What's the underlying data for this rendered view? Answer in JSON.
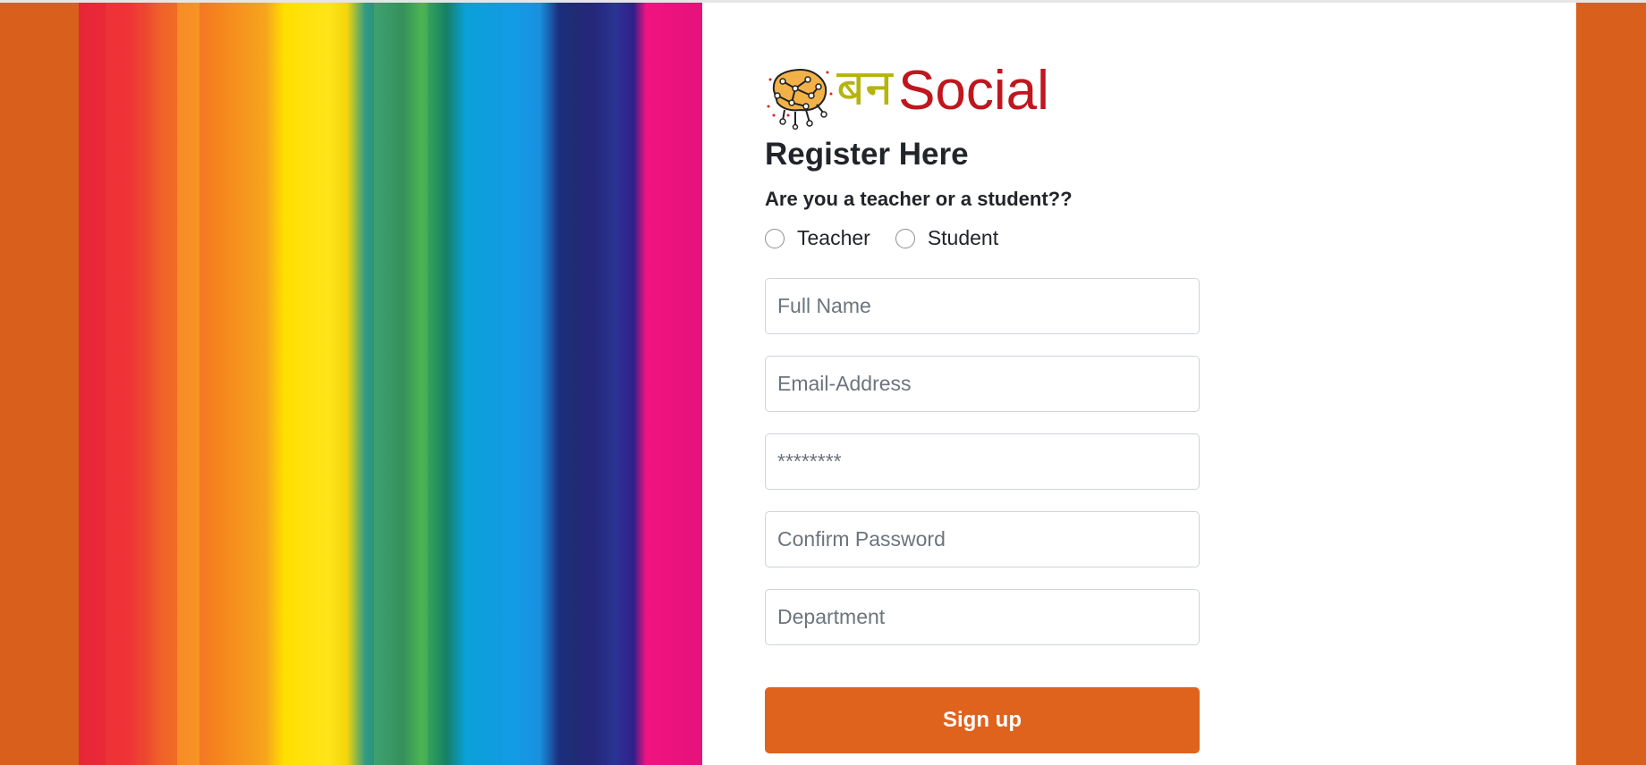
{
  "colors": {
    "page_background": "#d9601c",
    "button_background": "#e0631d",
    "brand_hindi": "#b5b40f",
    "brand_social": "#c0161e"
  },
  "brand": {
    "logo_icon": "brain-network-icon",
    "hindi_text": "बन",
    "social_text": "Social"
  },
  "form": {
    "title": "Register Here",
    "role_question": "Are you a teacher or a student??",
    "roles": [
      {
        "label": "Teacher",
        "selected": false
      },
      {
        "label": "Student",
        "selected": false
      }
    ],
    "fields": {
      "full_name_placeholder": "Full Name",
      "email_placeholder": "Email-Address",
      "password_placeholder": "********",
      "confirm_password_placeholder": "Confirm Password",
      "department_placeholder": "Department"
    },
    "submit_label": "Sign up"
  }
}
